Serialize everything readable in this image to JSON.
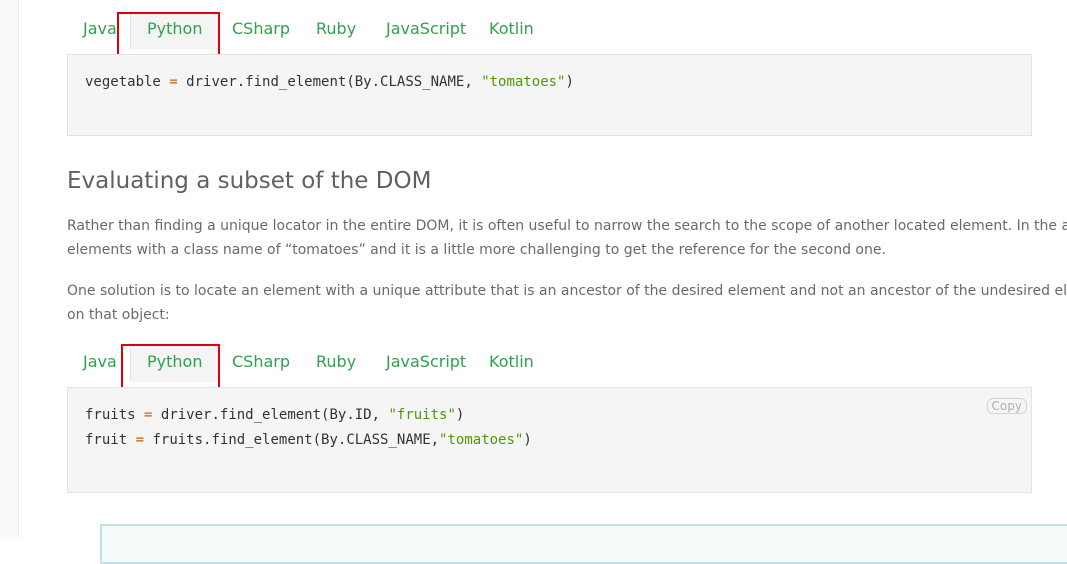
{
  "tabs_top": {
    "items": [
      "Java",
      "Python",
      "CSharp",
      "Ruby",
      "JavaScript",
      "Kotlin"
    ],
    "active": "Python"
  },
  "code_top": {
    "var": "vegetable",
    "op": "=",
    "call": "driver.find_element(By.CLASS_NAME, ",
    "arg": "\"tomatoes\"",
    "close": ")"
  },
  "section": {
    "heading": "Evaluating a subset of the DOM",
    "para1_line1": "Rather than finding a unique locator in the entire DOM, it is often useful to narrow the search to the scope of another located element. In the ab",
    "para1_line2": "elements with a class name of “tomatoes” and it is a little more challenging to get the reference for the second one.",
    "para2_line1": "One solution is to locate an element with a unique attribute that is an ancestor of the desired element and not an ancestor of the undesired elem",
    "para2_line2": "on that object:"
  },
  "tabs_bottom": {
    "items": [
      "Java",
      "Python",
      "CSharp",
      "Ruby",
      "JavaScript",
      "Kotlin"
    ],
    "active": "Python"
  },
  "code_bottom": {
    "line1_var": "fruits",
    "line1_op": "=",
    "line1_call": "driver.find_element(By.ID, ",
    "line1_arg": "\"fruits\"",
    "line1_close": ")",
    "line2_var": "fruit",
    "line2_op": "=",
    "line2_call": "fruits.find_element(By.CLASS_NAME,",
    "line2_arg": "\"tomatoes\"",
    "line2_close": ")",
    "copy_label": "Copy"
  },
  "colors": {
    "tab_text": "#30a14e",
    "highlight_border": "#e0000b",
    "string_literal": "#4e9a06",
    "operator": "#ce5c00"
  }
}
